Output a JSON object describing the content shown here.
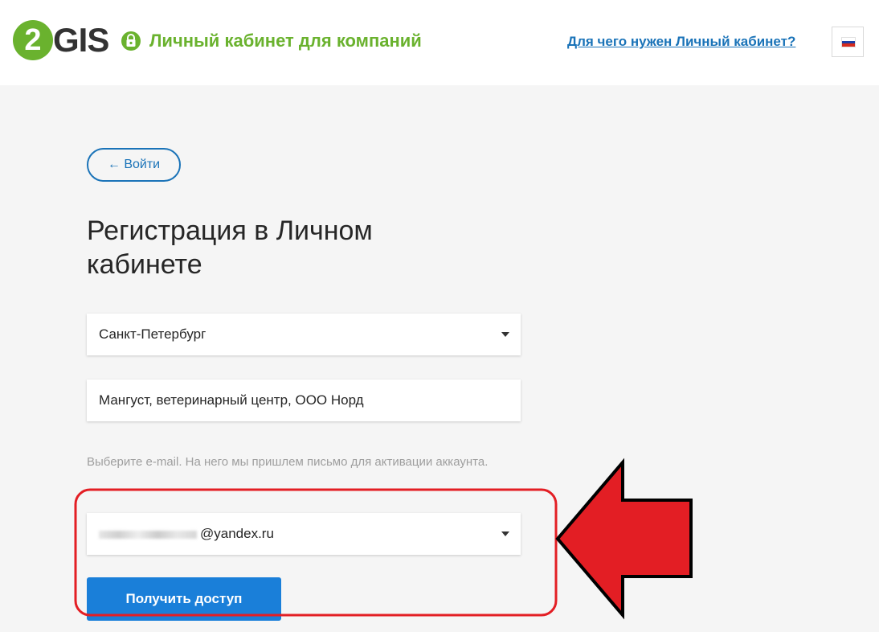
{
  "header": {
    "logo_number": "2",
    "logo_text": "GIS",
    "cabinet_title": "Личный кабинет для компаний",
    "help_link": "Для чего нужен Личный кабинет?",
    "language_flag": "russian-flag"
  },
  "back_button": {
    "label": "← Войти"
  },
  "page": {
    "title": "Регистрация в Личном кабинете"
  },
  "form": {
    "city": {
      "value": "Санкт-Петербург"
    },
    "company": {
      "value": "Мангуст, ветеринарный центр, ООО Норд"
    },
    "email_hint": "Выберите e-mail. На него мы пришлем письмо для активации аккаунта.",
    "email": {
      "value": "@yandex.ru"
    },
    "submit_label": "Получить доступ"
  },
  "colors": {
    "brand_green": "#6ab22e",
    "link_blue": "#1a73b8",
    "button_blue": "#1a7fd9",
    "annotation_red": "#e31e24"
  }
}
